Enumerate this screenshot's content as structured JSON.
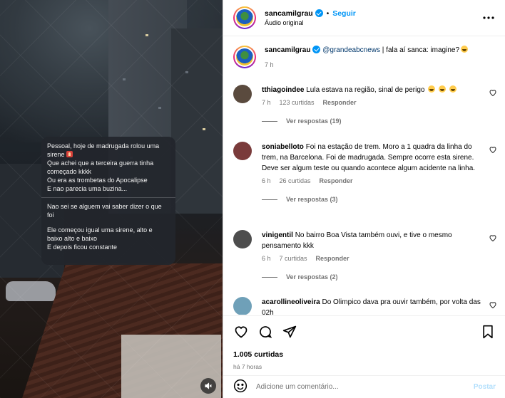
{
  "header": {
    "username": "sancamilgrau",
    "separator": "•",
    "follow_label": "Seguir",
    "audio_label": "Áudio original",
    "more_icon": "more-horizontal-icon"
  },
  "video": {
    "message_card": {
      "lines_block1": [
        "Pessoal, hoje de madrugada rolou uma",
        "sirene",
        "Que achei que a terceira guerra tinha",
        "começado kkkk",
        "Ou era as trombetas do Apocalipse",
        "E nao parecia uma buzina..."
      ],
      "lines_block2": [
        "Nao sei se alguem vai saber dizer o que",
        "foi"
      ],
      "lines_block3": [
        "Ele começou igual uma sirene, alto e",
        "baixo alto e baixo",
        "E depois ficou constante"
      ]
    },
    "mute_icon": "speaker-muted-icon"
  },
  "caption": {
    "username": "sancamilgrau",
    "mention": "@grandeabcnews",
    "text": " | fala aí sanca: imagine?",
    "time": "7 h"
  },
  "comments": [
    {
      "username": "tthiagoindee",
      "text": "Lula estava na região, sinal de perigo",
      "time": "7 h",
      "likes": "123 curtidas",
      "reply_label": "Responder",
      "view_replies": "Ver respostas (19)",
      "avatar_color": "#5a4a3e"
    },
    {
      "username": "soniabelloto",
      "text": "Foi na estação de trem. Moro a 1 quadra da linha do trem, na Barcelona. Foi de madrugada. Sempre ocorre esta sirene. Deve ser algum teste ou quando acontece algum acidente na linha.",
      "time": "6 h",
      "likes": "26 curtidas",
      "reply_label": "Responder",
      "view_replies": "Ver respostas (3)",
      "avatar_color": "#7a3b3b"
    },
    {
      "username": "vinigentil",
      "text": "No bairro Boa Vista também ouvi, e tive o mesmo pensamento kkk",
      "time": "6 h",
      "likes": "7 curtidas",
      "reply_label": "Responder",
      "view_replies": "Ver respostas (2)",
      "avatar_color": "#4d4d4d"
    },
    {
      "username": "acarollineoliveira",
      "text": "Do Olimpico dava pra ouvir também, por volta das 02h",
      "avatar_color": "#6fa0b8"
    }
  ],
  "actions": {
    "like_icon": "heart-icon",
    "comment_icon": "comment-icon",
    "share_icon": "send-icon",
    "save_icon": "bookmark-icon",
    "likes_count": "1.005 curtidas",
    "posted_ago": "há 7 horas"
  },
  "composer": {
    "emoji_icon": "emoji-icon",
    "placeholder": "Adicione um comentário...",
    "post_label": "Postar"
  }
}
